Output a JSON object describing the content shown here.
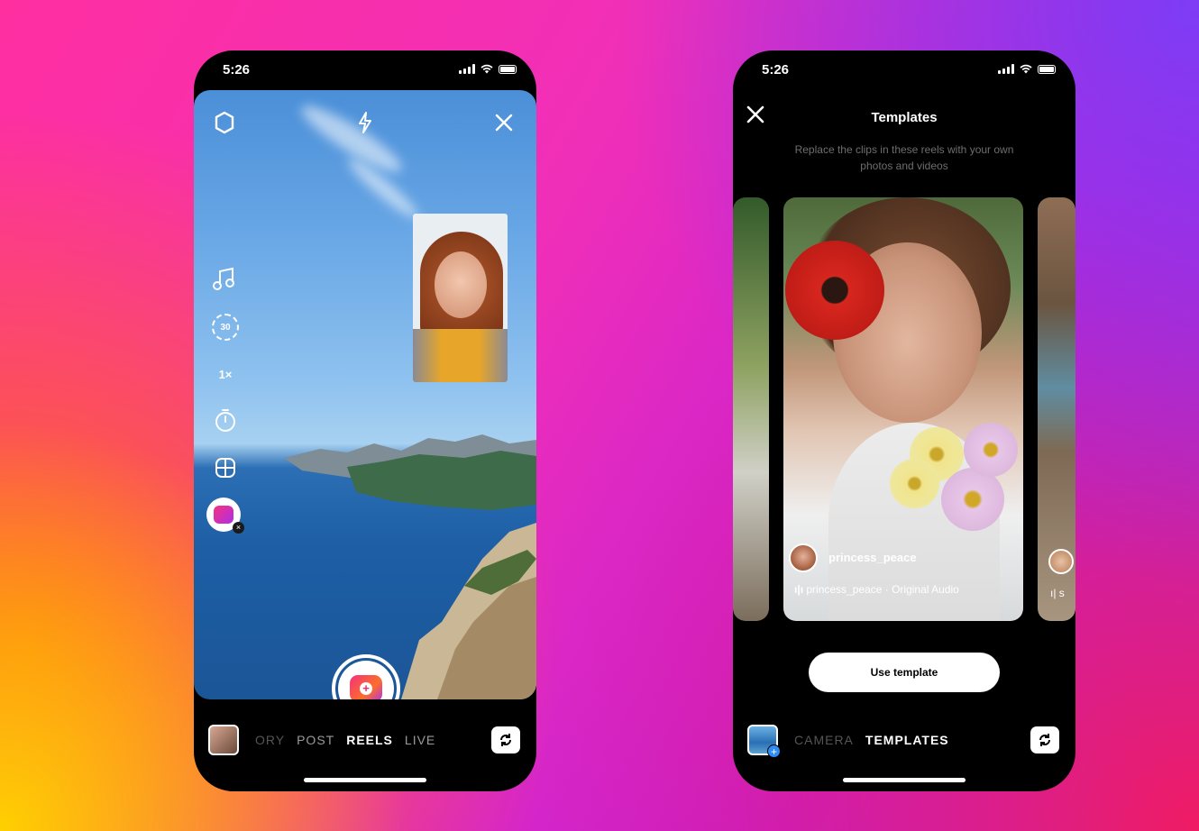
{
  "left_phone": {
    "status_time": "5:26",
    "tools": [
      {
        "icon": "music-note-icon"
      },
      {
        "icon": "timer-30-icon",
        "label": "30"
      },
      {
        "icon": "speed-icon",
        "label": "1×"
      },
      {
        "icon": "countdown-icon"
      },
      {
        "icon": "layout-icon"
      },
      {
        "icon": "effects-icon"
      }
    ],
    "top_icons": [
      "settings-icon",
      "flash-icon",
      "close-icon"
    ],
    "modes": [
      "ORY",
      "POST",
      "REELS",
      "LIVE"
    ],
    "active_mode": "REELS"
  },
  "right_phone": {
    "status_time": "5:26",
    "title": "Templates",
    "subtitle": "Replace the clips in these reels with your own photos and videos",
    "card": {
      "username": "princess_peace",
      "audio": "princess_peace · Original Audio"
    },
    "next_card_audio": "ı| s",
    "use_template": "Use template",
    "modes": [
      "CAMERA",
      "TEMPLATES"
    ],
    "active_mode": "TEMPLATES"
  },
  "colors": {
    "background_start": "#ff2fa0",
    "background_end": "#7d3cf5",
    "accent": "#f02868"
  }
}
